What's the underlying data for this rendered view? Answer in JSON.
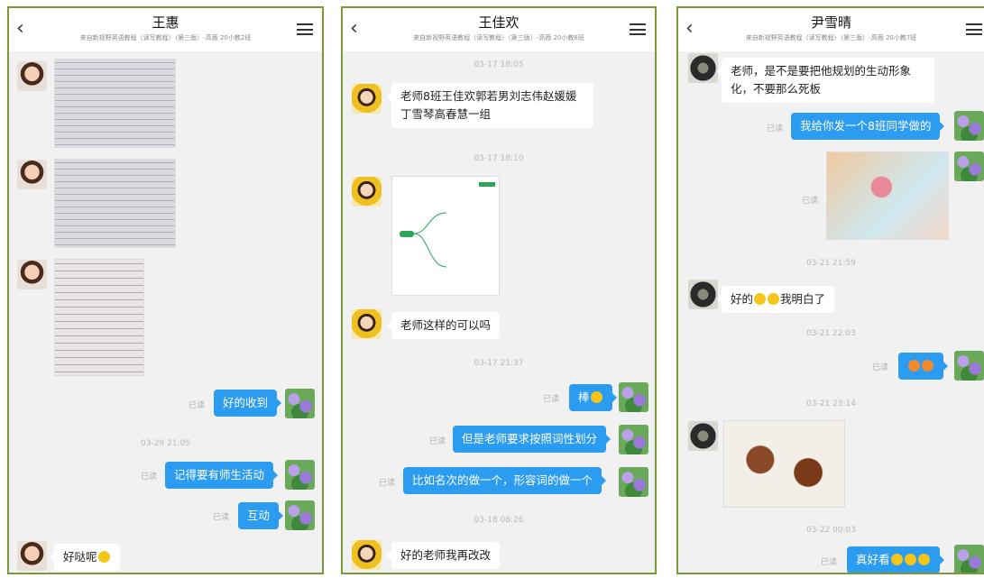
{
  "panel1": {
    "title": "王惠",
    "subtitle": "来自新视野英语教程（读写教程）（第三版）-高薇 20小教2班",
    "ts1": "03-29 21:05",
    "read": "已读",
    "msg_out1": "好的收到",
    "msg_out2": "记得要有师生活动",
    "msg_out3": "互动",
    "msg_in1": "好哒呢"
  },
  "panel2": {
    "title": "王佳欢",
    "subtitle": "来自新视野英语教程（读写教程）（第三版）-高薇 20小教8班",
    "ts1": "03-17 18:05",
    "ts2": "03-17 18:10",
    "ts3": "03-17 21:37",
    "ts4": "03-18 08:26",
    "read": "已读",
    "msg_in1": "老师8班王佳欢郭若男刘志伟赵媛媛丁雪琴高春慧一组",
    "msg_in2": "老师这样的可以吗",
    "msg_out1": "棒",
    "msg_out2": "但是老师要求按照词性划分",
    "msg_out3": "比如名次的做一个，形容词的做一个",
    "msg_in3": "好的老师我再改改"
  },
  "panel3": {
    "title": "尹雪晴",
    "subtitle": "来自新视野英语教程（读写教程）（第三版）-高薇 20小教7班",
    "ts1": "03-21 21:59",
    "ts2": "03-21 22:03",
    "ts3": "03-21 23:14",
    "ts4": "03-22 00:03",
    "read": "已读",
    "msg_in1": "老师，是不是要把他规划的生动形象化，不要那么死板",
    "msg_out1": "我给你发一个8班同学做的",
    "msg_in2_a": "好的",
    "msg_in2_b": "我明白了",
    "msg_out3": "真好看"
  },
  "icons": {
    "back": "chevron-left-icon",
    "menu": "hamburger-menu-icon",
    "emoji": "emoji-icon"
  },
  "colors": {
    "bubble_out": "#2c9cf0",
    "bubble_in": "#ffffff",
    "panel_border": "#7a9a3a"
  }
}
